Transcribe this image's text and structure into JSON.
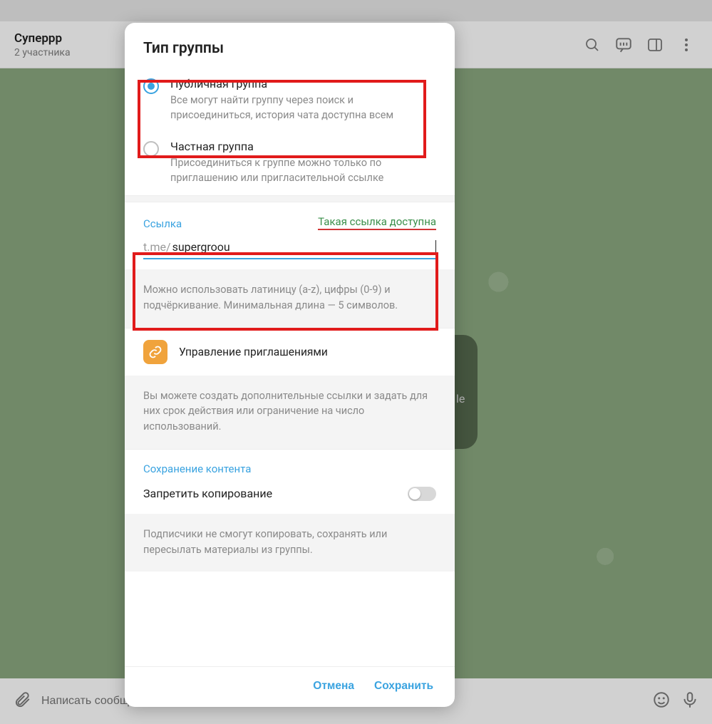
{
  "header": {
    "chat_title": "Суперрр",
    "chat_subtitle": "2 участника"
  },
  "modal": {
    "title": "Тип группы",
    "options": {
      "public": {
        "title": "Публичная группа",
        "desc": "Все могут найти группу через поиск и присоединиться, история чата доступна всем"
      },
      "private": {
        "title": "Частная группа",
        "desc": "Присоединиться к группе можно только по приглашению или пригласительной ссылке"
      }
    },
    "link": {
      "label": "Ссылка",
      "status": "Такая ссылка доступна",
      "prefix": "t.me/",
      "value": "supergroou"
    },
    "link_hint": "Можно использовать латиницу (a-z), цифры (0-9) и подчёркивание. Минимальная длина — 5 символов.",
    "invites_label": "Управление приглашениями",
    "invites_hint": "Вы можете создать дополнительные ссылки и задать для них срок действия или ограничение на число использований.",
    "content_section": "Сохранение контента",
    "forbid_copy": "Запретить копирование",
    "forbid_copy_hint": "Подписчики не смогут копировать, сохранять или пересылать материалы из группы.",
    "cancel": "Отмена",
    "save": "Сохранить"
  },
  "composer": {
    "placeholder": "Написать сообщение..."
  },
  "ghost": {
    "le": "le"
  }
}
